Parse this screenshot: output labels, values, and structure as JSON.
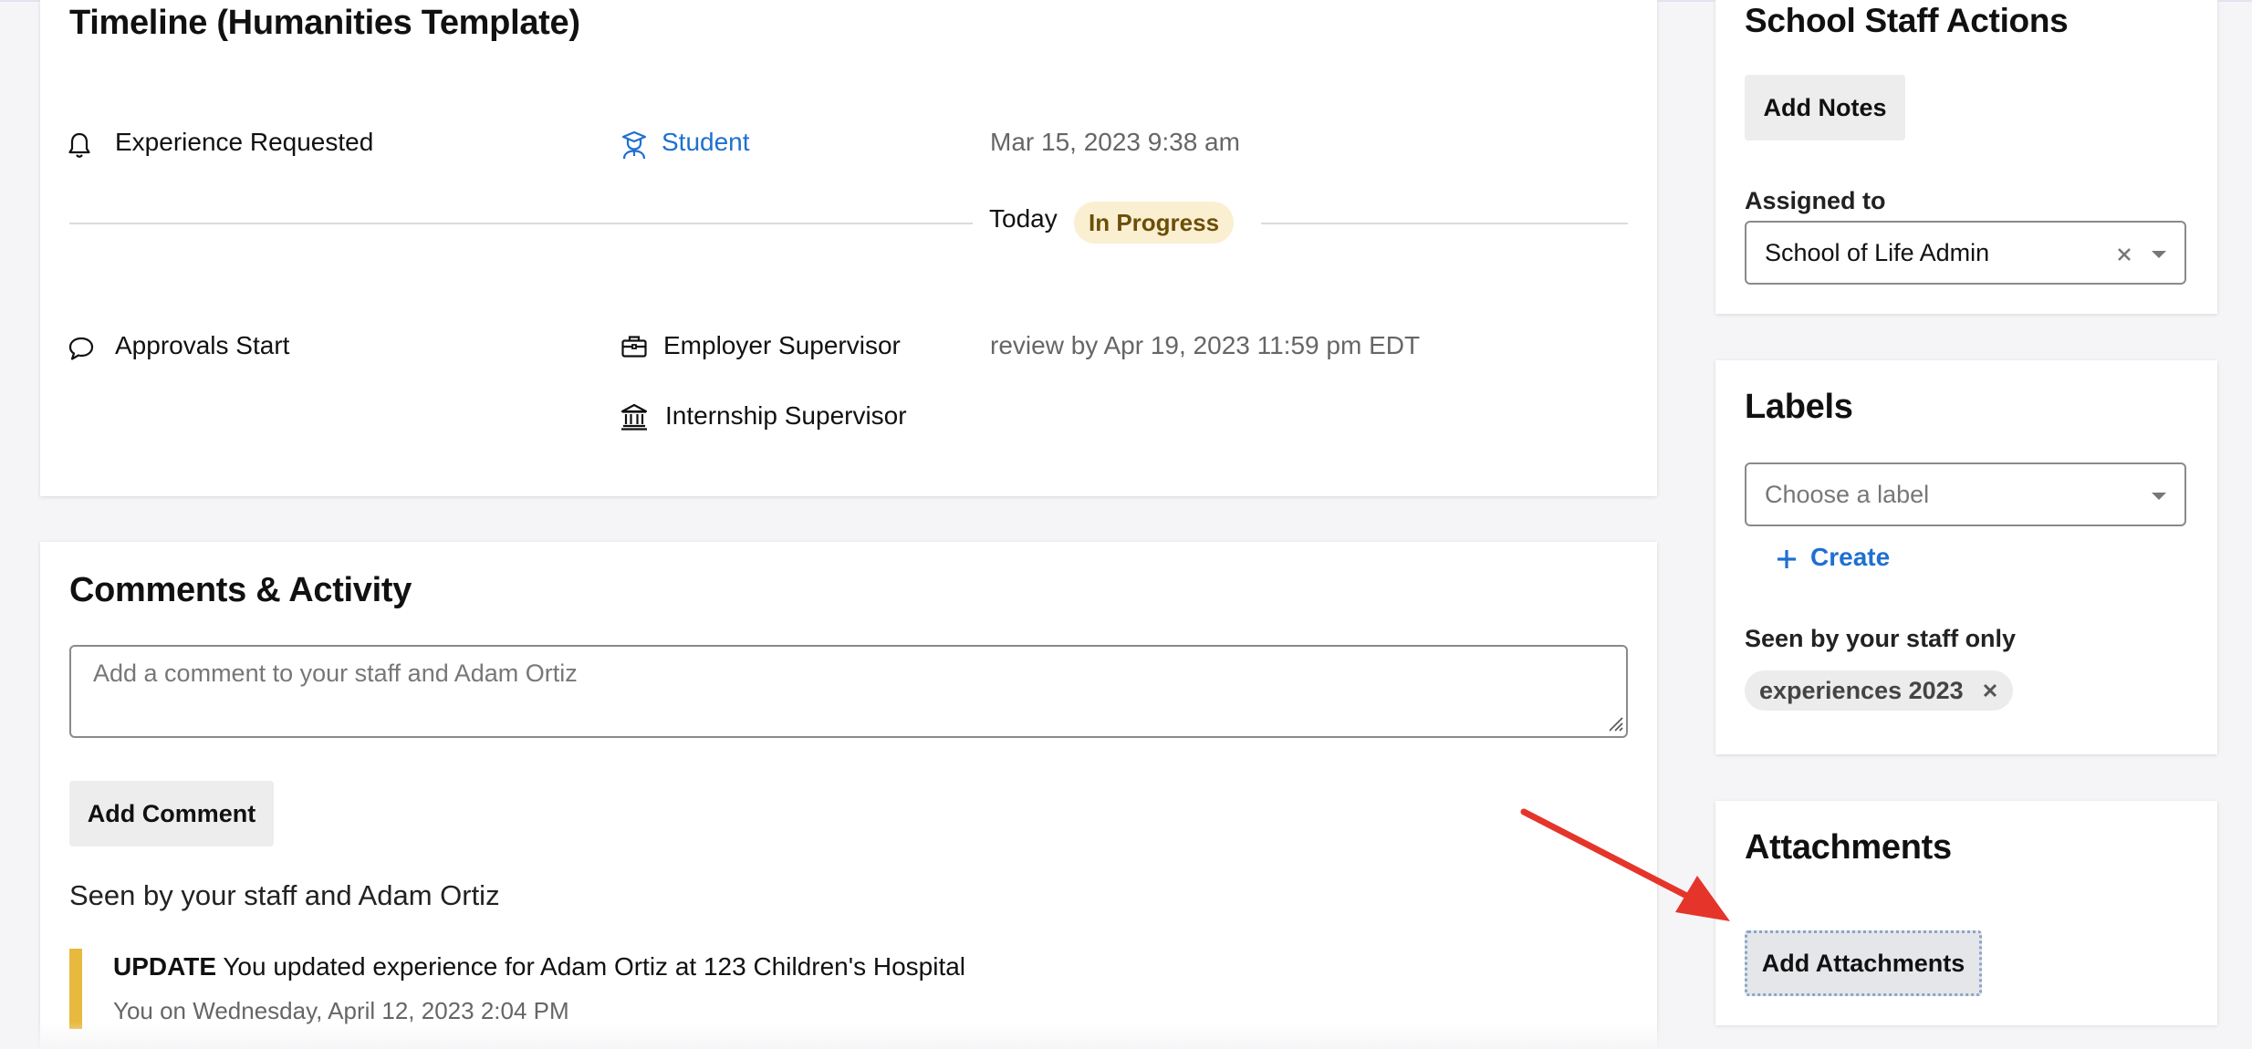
{
  "timeline": {
    "title": "Timeline (Humanities Template)",
    "today_label": "Today",
    "status_badge": "In Progress",
    "events": [
      {
        "name": "Experience Requested",
        "icon": "bell-icon",
        "actor": "Student",
        "actor_icon": "student-icon",
        "timestamp": "Mar 15, 2023 9:38 am"
      },
      {
        "name": "Approvals Start",
        "icon": "speech-bubble-icon",
        "actors": [
          {
            "label": "Employer Supervisor",
            "icon": "briefcase-icon"
          },
          {
            "label": "Internship Supervisor",
            "icon": "institution-icon"
          }
        ],
        "timestamp": "review by Apr 19, 2023 11:59 pm EDT"
      }
    ]
  },
  "comments": {
    "title": "Comments & Activity",
    "input_placeholder": "Add a comment to your staff and Adam Ortiz",
    "add_button": "Add Comment",
    "visibility_note": "Seen by your staff and Adam Ortiz",
    "activity": [
      {
        "type": "UPDATE",
        "message": "You updated experience for Adam Ortiz at 123 Children's Hospital",
        "meta": "You on Wednesday, April 12, 2023 2:04 PM"
      }
    ]
  },
  "staff_actions": {
    "title": "School Staff Actions",
    "add_notes_button": "Add Notes",
    "assigned_label": "Assigned to",
    "assigned_value": "School of Life Admin"
  },
  "labels": {
    "title": "Labels",
    "select_placeholder": "Choose a label",
    "create_link": "Create",
    "visibility_note": "Seen by your staff only",
    "chips": [
      "experiences 2023"
    ]
  },
  "attachments": {
    "title": "Attachments",
    "add_button": "Add Attachments"
  },
  "colors": {
    "accent_blue": "#1f6fd1",
    "badge_bg": "#fbefd2",
    "badge_text": "#6b4f08",
    "update_bar": "#e7b93e",
    "annotation_arrow": "#e5352b"
  }
}
